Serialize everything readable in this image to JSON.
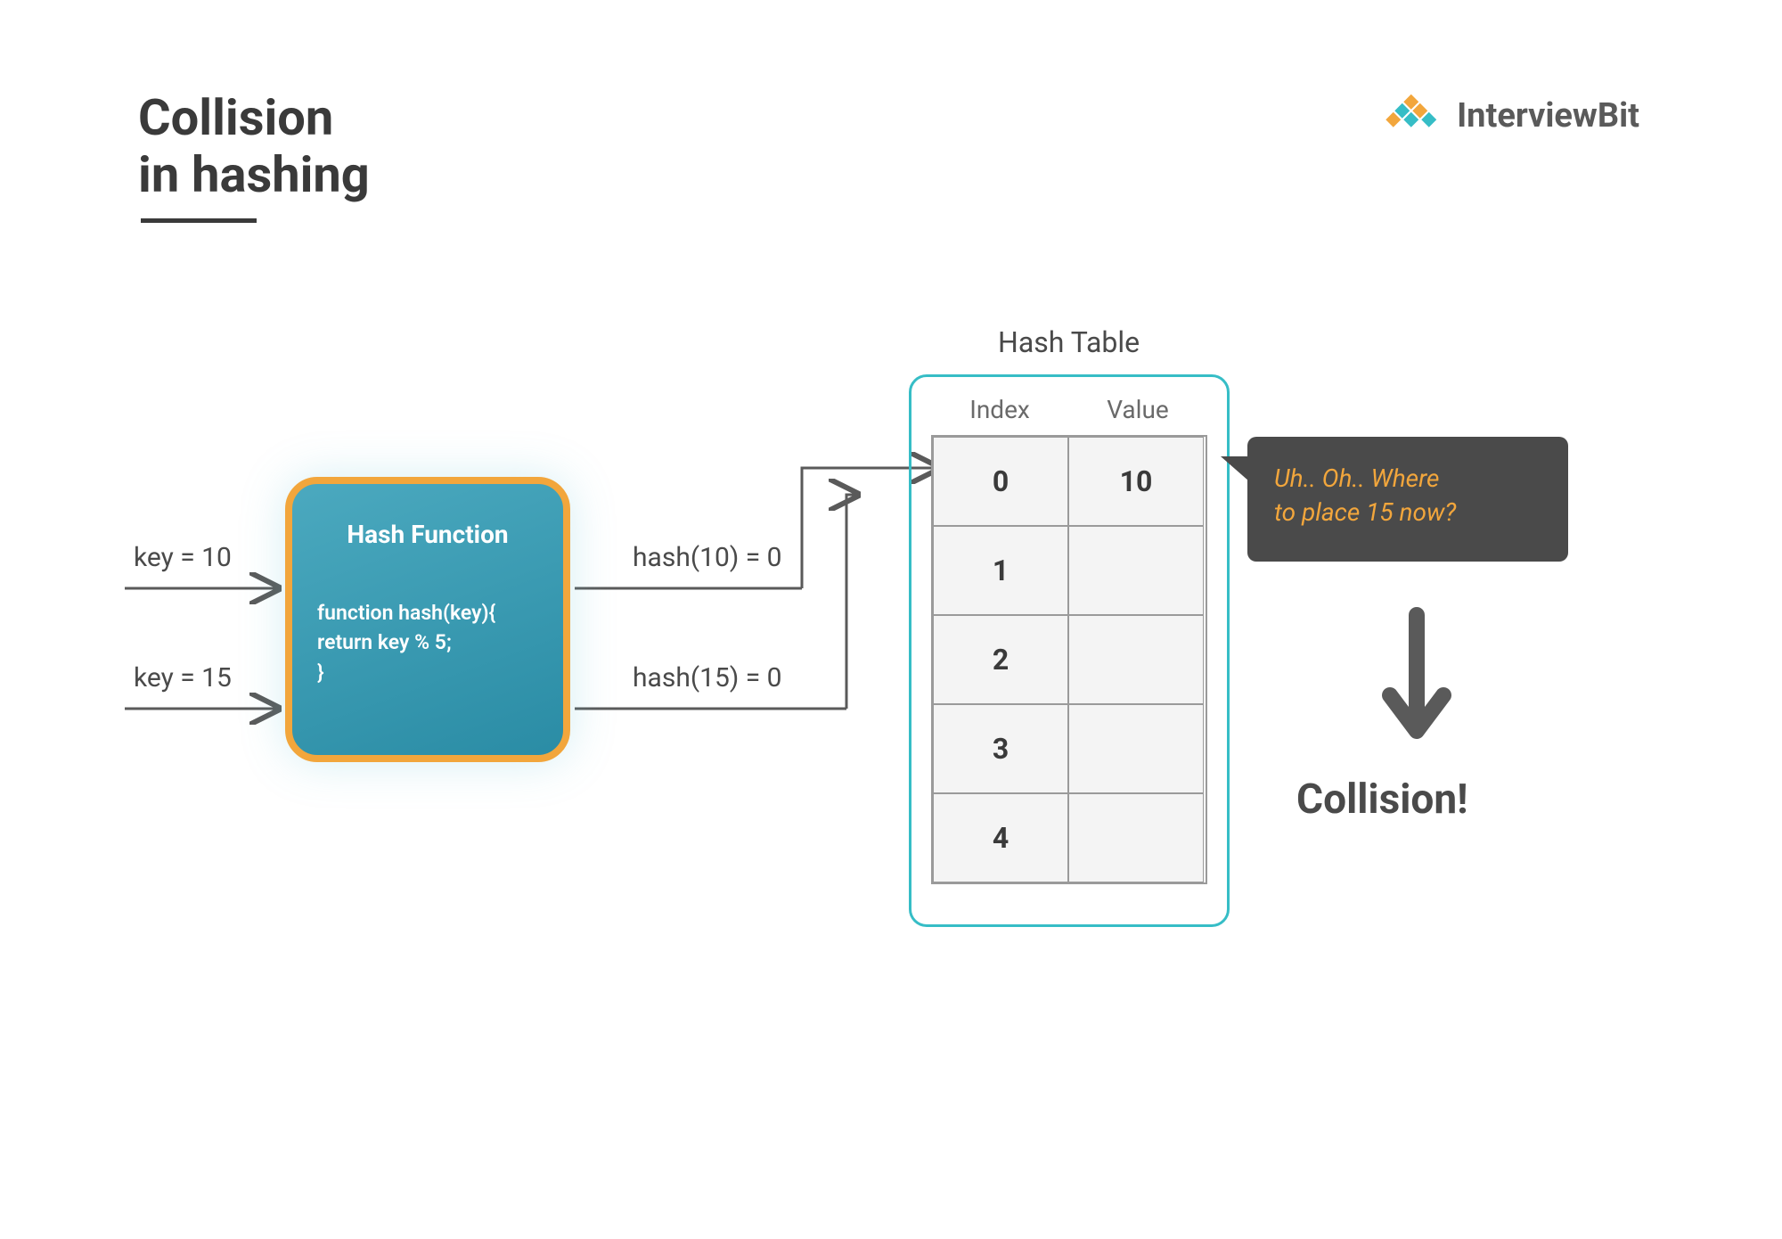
{
  "title_line1": "Collision",
  "title_line2": "in hashing",
  "brand": "InterviewBit",
  "inputs": {
    "key1": "key = 10",
    "key2": "key = 15"
  },
  "hash_function": {
    "title": "Hash Function",
    "code": "function hash(key){\nreturn key % 5;\n}"
  },
  "outputs": {
    "out1": "hash(10) = 0",
    "out2": "hash(15) = 0"
  },
  "hash_table": {
    "title": "Hash Table",
    "headers": {
      "index": "Index",
      "value": "Value"
    },
    "rows": [
      {
        "index": "0",
        "value": "10"
      },
      {
        "index": "1",
        "value": ""
      },
      {
        "index": "2",
        "value": ""
      },
      {
        "index": "3",
        "value": ""
      },
      {
        "index": "4",
        "value": ""
      }
    ]
  },
  "speech": {
    "line1": "Uh.. Oh.. Where",
    "line2": "to place 15 now?"
  },
  "collision_label": "Collision!"
}
